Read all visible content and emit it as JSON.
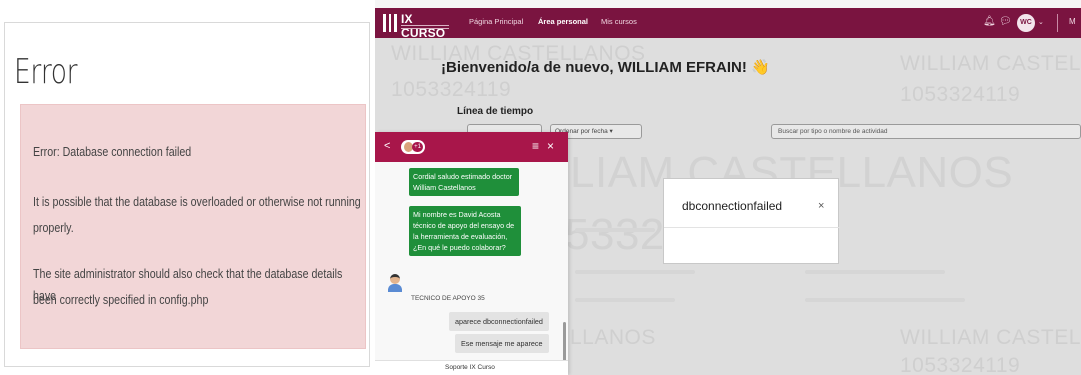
{
  "error_page": {
    "title": "Error",
    "message": "Error: Database connection failed",
    "line1a": "It is possible that the database is overloaded or otherwise not running",
    "line1b": "properly.",
    "line2a": "The site administrator should also check that the database details have",
    "line2b": "been correctly specified in config.php"
  },
  "app": {
    "brand": "IX CURSO",
    "nav": [
      "Página Principal",
      "Área personal",
      "Mis cursos"
    ],
    "user_initials": "WC",
    "user_menu_partial": "M",
    "watermark_name_full": "WILLIAM CASTELLANOS",
    "watermark_name_partial": "WILLIAM CASTEL",
    "watermark_name_tail": "LIAM CASTELLANOS",
    "watermark_name_short": "LLANOS",
    "watermark_id": "1053324119",
    "watermark_id_tail": "53324119",
    "welcome": "¡Bienvenido/a de nuevo, WILLIAM EFRAIN! 👋",
    "timeline_label": "Línea de tiempo",
    "sort_button": "Ordenar por fecha ▾",
    "search_placeholder": "Buscar por tipo o nombre de actividad",
    "modal_text": "dbconnectionfailed",
    "modal_close": "×"
  },
  "chat": {
    "back": "<",
    "badge": "+1",
    "menu": "≡",
    "close": "×",
    "messages_agent": [
      "Cordial saludo estimado doctor William Castellanos",
      "Mi nombre es David Acosta técnico de apoyo del ensayo de la herramienta de evaluación, ¿En qué le puedo colaborar?"
    ],
    "agent_name": "TECNICO DE APOYO 35",
    "messages_user": [
      "aparece dbconnectionfailed",
      "Ese mensaje me aparece"
    ],
    "footer": "Soporte IX Curso"
  },
  "colors": {
    "brand": "#7a1440",
    "chat_header": "#a8164a",
    "agent_bubble": "#1f8f3a",
    "error_bg": "#f2d6d7"
  }
}
